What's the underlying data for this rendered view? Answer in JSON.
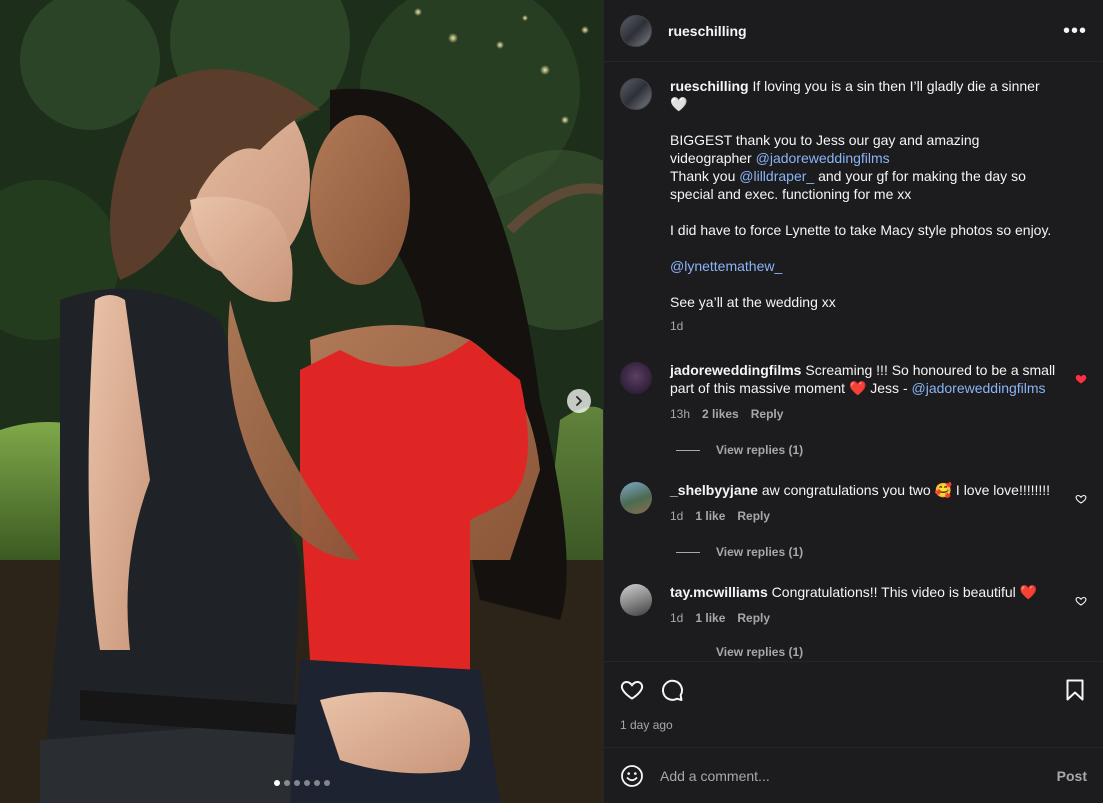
{
  "post": {
    "username": "rueschilling",
    "more_label": "•••",
    "caption": {
      "username": "rueschilling",
      "line1": "If loving you is a sin then I’ll gladly die a sinner 🤍",
      "p2_a": "BIGGEST thank you to Jess our gay and amazing videographer ",
      "p2_mention": "@jadoreweddingfilms",
      "p2_b": "Thank you ",
      "p2_mention2": "@lilldraper_",
      "p2_c": " and your gf for making the day so special and exec. functioning for me xx",
      "p3": "I did have to force Lynette to take Macy style photos so enjoy.",
      "p4_mention": "@lynettemathew_",
      "p5": "See ya’ll at the wedding xx",
      "time": "1d"
    },
    "comments": [
      {
        "username": "jadoreweddingfilms",
        "text": " Screaming !!! So honoured to be a small part of this massive moment ❤️ Jess - ",
        "mention": "@jadoreweddingfilms",
        "time": "13h",
        "likes": "2 likes",
        "reply": "Reply",
        "view_replies": "View replies (1)",
        "liked": true
      },
      {
        "username": "_shelbyyjane",
        "text": " aw congratulations you two 🥰 I love love!!!!!!!!",
        "time": "1d",
        "likes": "1 like",
        "reply": "Reply",
        "view_replies": "View replies (1)",
        "liked": false
      },
      {
        "username": "tay.mcwilliams",
        "text": " Congratulations!! This video is beautiful ❤️",
        "time": "1d",
        "likes": "1 like",
        "reply": "Reply",
        "view_replies": "View replies (1)",
        "liked": false
      }
    ],
    "post_age": "1 day ago",
    "add_comment_placeholder": "Add a comment...",
    "post_button": "Post",
    "carousel": {
      "total": 6,
      "active": 1
    }
  },
  "colors": {
    "background": "#1c1c1e",
    "mention": "#8ab4f8",
    "liked_heart": "#ff3040",
    "muted": "#a8a8a8"
  }
}
